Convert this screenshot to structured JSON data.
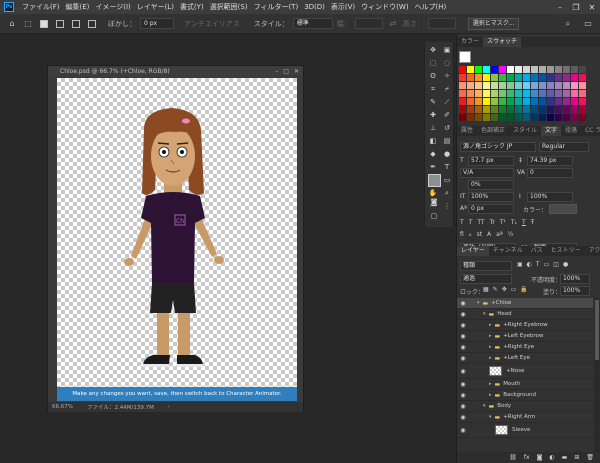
{
  "menubar": {
    "logo": "Ps",
    "items": [
      "ファイル(F)",
      "編集(E)",
      "イメージ(I)",
      "レイヤー(L)",
      "書式(Y)",
      "選択範囲(S)",
      "フィルター(T)",
      "3D(D)",
      "表示(V)",
      "ウィンドウ(W)",
      "ヘルプ(H)"
    ]
  },
  "options": {
    "feather_label": "ぼかし：",
    "feather_value": "0 px",
    "antialias_label": "アンチエイリアス",
    "style_label": "スタイル：",
    "style_value": "標準",
    "width_label": "幅：",
    "height_label": "高さ：",
    "mask_button": "選択とマスク..."
  },
  "document": {
    "title": "Chloe.psd @ 66.7% (+Chloe, RGB/8)",
    "badge": "Ch",
    "banner": "Make any changes you want, save, then switch back to Character Animator.",
    "zoom": "66.67%",
    "file_info": "ファイル：2.44M/139.7M"
  },
  "swatches_panel": {
    "tabs": [
      "カラー",
      "スウォッチ"
    ],
    "rows": [
      [
        "#ff0000",
        "#ffff00",
        "#00ff00",
        "#00ffff",
        "#0000ff",
        "#ff00ff",
        "#ffffff",
        "#ebebeb",
        "#d6d6d6",
        "#c2c2c2",
        "#adadad",
        "#999999",
        "#858585",
        "#707070",
        "#5c5c5c",
        "#474747"
      ],
      [
        "#ff3333",
        "#f26522",
        "#f7941d",
        "#fff200",
        "#8dc63f",
        "#39b54a",
        "#00a651",
        "#00a99d",
        "#00aeef",
        "#0072bc",
        "#0054a6",
        "#2e3192",
        "#662d91",
        "#92278f",
        "#ec008c",
        "#ed145b"
      ],
      [
        "#f7977a",
        "#f9ad81",
        "#fdc68a",
        "#fff79a",
        "#c4df9b",
        "#a3d39c",
        "#82ca9d",
        "#7bcdc8",
        "#6ecff6",
        "#7ea7d8",
        "#8493ca",
        "#8882be",
        "#a187be",
        "#bc8dbf",
        "#f49ac2",
        "#f6989d"
      ],
      [
        "#f26c4f",
        "#f68e55",
        "#fbaf5c",
        "#fff467",
        "#acd372",
        "#7cc576",
        "#3bb878",
        "#1abbb4",
        "#00bff3",
        "#438ccb",
        "#5574b9",
        "#605ca8",
        "#855fa8",
        "#a763a8",
        "#f06ea9",
        "#f26d7d"
      ],
      [
        "#ed1c24",
        "#f26522",
        "#f7941d",
        "#fff200",
        "#8dc63f",
        "#39b54a",
        "#00a651",
        "#00a99d",
        "#00aeef",
        "#0072bc",
        "#0054a6",
        "#2e3192",
        "#662d91",
        "#92278f",
        "#ec008c",
        "#ed145b"
      ],
      [
        "#9e0b0f",
        "#a0410d",
        "#a3620a",
        "#aba000",
        "#598527",
        "#1a7b30",
        "#007236",
        "#00746b",
        "#0076a3",
        "#004a80",
        "#003471",
        "#1b1464",
        "#440e62",
        "#630460",
        "#9e005d",
        "#9e0039"
      ],
      [
        "#790000",
        "#7b2e00",
        "#7d4900",
        "#827b00",
        "#406618",
        "#005e20",
        "#005826",
        "#005952",
        "#005b7f",
        "#003663",
        "#002157",
        "#0d004c",
        "#32004b",
        "#4b0049",
        "#7b0046",
        "#7a0026"
      ]
    ]
  },
  "char_panel": {
    "tabs": [
      "属性",
      "色調補正",
      "スタイル",
      "文字",
      "段落",
      "CC ライブ"
    ],
    "font": "源ノ角ゴシック JP",
    "weight": "Regular",
    "size": "57.7 px",
    "leading": "74.39 px",
    "kerning": "V/A",
    "tracking": "0",
    "tsume": "0%",
    "vscale": "100%",
    "hscale": "100%",
    "baseline": "0 px",
    "color_label": "カラー：",
    "language": "英語（米国）",
    "aa": "aa",
    "aa_mode": "鮮明",
    "type_buttons": [
      "T",
      "T",
      "TT",
      "Tr",
      "T¹",
      "T₁",
      "T",
      "Ŧ"
    ]
  },
  "layers_panel": {
    "tabs": [
      "レイヤー",
      "チャンネル",
      "パス",
      "ヒストリー",
      "アクション"
    ],
    "filter": "種類",
    "mode": "通過",
    "opacity_label": "不透明度：",
    "opacity": "100%",
    "lock_label": "ロック：",
    "fill_label": "塗り：",
    "fill": "100%",
    "layers": [
      {
        "name": "+Chloe",
        "type": "group",
        "indent": 0,
        "selected": true
      },
      {
        "name": "Head",
        "type": "group",
        "indent": 1
      },
      {
        "name": "+Right Eyebrow",
        "type": "group",
        "indent": 2
      },
      {
        "name": "+Left Eyebrow",
        "type": "group",
        "indent": 2
      },
      {
        "name": "+Right Eye",
        "type": "group",
        "indent": 2
      },
      {
        "name": "+Left Eye",
        "type": "group",
        "indent": 2
      },
      {
        "name": "+Nose",
        "type": "layer",
        "indent": 2
      },
      {
        "name": "Mouth",
        "type": "group",
        "indent": 2
      },
      {
        "name": "Background",
        "type": "group",
        "indent": 2
      },
      {
        "name": "Body",
        "type": "group",
        "indent": 1
      },
      {
        "name": "+Right Arm",
        "type": "group",
        "indent": 2
      },
      {
        "name": "Sleeve",
        "type": "layer",
        "indent": 3
      }
    ],
    "footer_icons": [
      "link-icon",
      "fx-icon",
      "mask-icon",
      "adjustment-icon",
      "folder-icon",
      "new-layer-icon",
      "trash-icon"
    ]
  },
  "colors": {
    "shirt": "#2c1233",
    "skin": "#c89a68",
    "hair": "#8b4a22",
    "banner": "#2f7fbf",
    "pants": "#222222"
  }
}
